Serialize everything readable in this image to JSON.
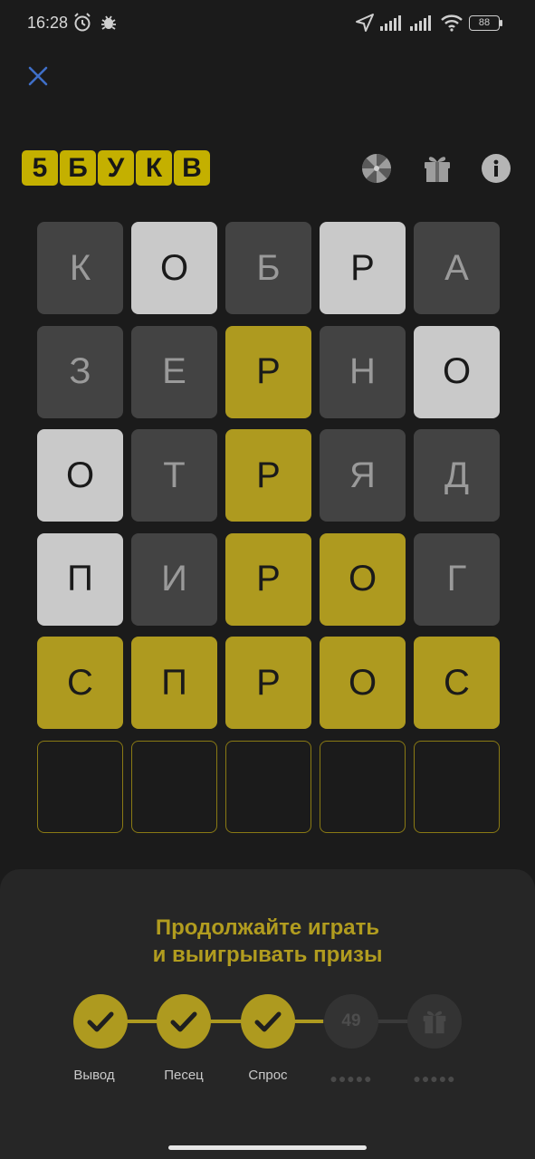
{
  "status": {
    "time": "16:28",
    "battery": "88",
    "icons": [
      "alarm-icon",
      "bug-icon",
      "location-icon",
      "signal-icon",
      "signal-icon",
      "wifi-icon",
      "battery-icon"
    ]
  },
  "header": {
    "close_icon": "close-icon",
    "logo": [
      "5",
      "Б",
      "У",
      "К",
      "В"
    ],
    "icons": [
      "wheel-icon",
      "gift-icon",
      "info-icon"
    ]
  },
  "colors": {
    "accent": "#ae9a1f",
    "absent": "#434343",
    "present": "#c9c9c9",
    "background": "#1b1b1b"
  },
  "board": {
    "rows": [
      [
        {
          "l": "К",
          "s": "absent"
        },
        {
          "l": "О",
          "s": "present"
        },
        {
          "l": "Б",
          "s": "absent"
        },
        {
          "l": "Р",
          "s": "present"
        },
        {
          "l": "А",
          "s": "absent"
        }
      ],
      [
        {
          "l": "З",
          "s": "absent"
        },
        {
          "l": "Е",
          "s": "absent"
        },
        {
          "l": "Р",
          "s": "correct"
        },
        {
          "l": "Н",
          "s": "absent"
        },
        {
          "l": "О",
          "s": "present"
        }
      ],
      [
        {
          "l": "О",
          "s": "present"
        },
        {
          "l": "Т",
          "s": "absent"
        },
        {
          "l": "Р",
          "s": "correct"
        },
        {
          "l": "Я",
          "s": "absent"
        },
        {
          "l": "Д",
          "s": "absent"
        }
      ],
      [
        {
          "l": "П",
          "s": "present"
        },
        {
          "l": "И",
          "s": "absent"
        },
        {
          "l": "Р",
          "s": "correct"
        },
        {
          "l": "О",
          "s": "correct"
        },
        {
          "l": "Г",
          "s": "absent"
        }
      ],
      [
        {
          "l": "С",
          "s": "correct"
        },
        {
          "l": "П",
          "s": "correct"
        },
        {
          "l": "Р",
          "s": "correct"
        },
        {
          "l": "О",
          "s": "correct"
        },
        {
          "l": "С",
          "s": "correct"
        }
      ],
      [
        {
          "l": "",
          "s": "empty"
        },
        {
          "l": "",
          "s": "empty"
        },
        {
          "l": "",
          "s": "empty"
        },
        {
          "l": "",
          "s": "empty"
        },
        {
          "l": "",
          "s": "empty"
        }
      ]
    ]
  },
  "panel": {
    "title_line1": "Продолжайте играть",
    "title_line2": "и выигрывать призы",
    "steps": [
      {
        "state": "done",
        "label": "Вывод"
      },
      {
        "state": "done",
        "label": "Песец"
      },
      {
        "state": "done",
        "label": "Спрос"
      },
      {
        "state": "todo",
        "value": "49",
        "label": "●●●●●"
      },
      {
        "state": "todo",
        "icon": "gift-icon",
        "label": "●●●●●"
      }
    ]
  }
}
